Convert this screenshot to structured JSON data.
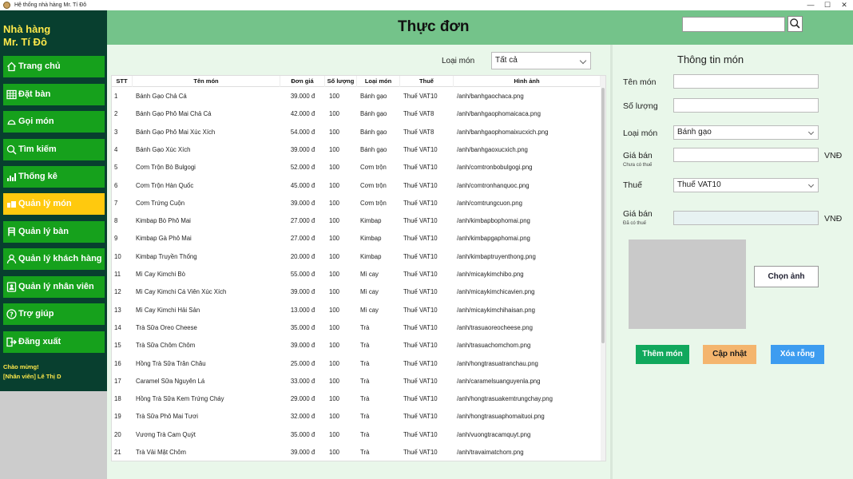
{
  "window": {
    "title": "Hệ thống nhà hàng Mr. Tí Đô",
    "controls": [
      "—",
      "☐",
      "✕"
    ]
  },
  "sidebar": {
    "brand_line1": "Nhà hàng",
    "brand_line2": "Mr. Tí Đô",
    "items": [
      {
        "label": "Trang chủ",
        "icon": "home-icon"
      },
      {
        "label": "Đặt bàn",
        "icon": "calendar-icon"
      },
      {
        "label": "Gọi món",
        "icon": "dish-icon"
      },
      {
        "label": "Tìm kiếm",
        "icon": "search-icon"
      },
      {
        "label": "Thống kê",
        "icon": "chart-icon"
      },
      {
        "label": "Quản lý món",
        "icon": "menu-icon",
        "active": true
      },
      {
        "label": "Quản lý bàn",
        "icon": "table-icon"
      },
      {
        "label": "Quản lý khách hàng",
        "icon": "user-icon"
      },
      {
        "label": "Quản lý nhân viên",
        "icon": "staff-icon"
      },
      {
        "label": "Trợ giúp",
        "icon": "help-icon"
      },
      {
        "label": "Đăng xuất",
        "icon": "logout-icon"
      }
    ],
    "greeting": "Chào mừng!",
    "user": "[Nhân viên] Lê Thị D"
  },
  "header": {
    "title": "Thực đơn",
    "search_value": ""
  },
  "filter": {
    "label": "Loại món",
    "value": "Tất cả"
  },
  "table": {
    "columns": [
      "STT",
      "Tên món",
      "Đơn giá",
      "Số lượng",
      "Loại món",
      "Thuế",
      "Hình ảnh"
    ],
    "rows": [
      [
        "1",
        "Bánh Gạo Chả Cá",
        "39.000 đ",
        "100",
        "Bánh gạo",
        "Thuế VAT10",
        "/anh/banhgaochaca.png"
      ],
      [
        "2",
        "Bánh Gạo Phô Mai Chả Cá",
        "42.000 đ",
        "100",
        "Bánh gạo",
        "Thuế VAT8",
        "/anh/banhgaophomaicaca.png"
      ],
      [
        "3",
        "Bánh Gạo Phô Mai Xúc Xích",
        "54.000 đ",
        "100",
        "Bánh gạo",
        "Thuế VAT8",
        "/anh/banhgaophomaixucxich.png"
      ],
      [
        "4",
        "Bánh Gạo Xúc Xích",
        "39.000 đ",
        "100",
        "Bánh gạo",
        "Thuế VAT10",
        "/anh/banhgaoxucxich.png"
      ],
      [
        "5",
        "Cơm Trộn Bò Bulgogi",
        "52.000 đ",
        "100",
        "Cơm trộn",
        "Thuế VAT10",
        "/anh/comtronbobulgogi.png"
      ],
      [
        "6",
        "Cơm Trộn Hàn Quốc",
        "45.000 đ",
        "100",
        "Cơm trộn",
        "Thuế VAT10",
        "/anh/comtronhanquoc.png"
      ],
      [
        "7",
        "Cơm Trứng Cuộn",
        "39.000 đ",
        "100",
        "Cơm trộn",
        "Thuế VAT10",
        "/anh/comtrungcuon.png"
      ],
      [
        "8",
        "Kimbap Bò Phô Mai",
        "27.000 đ",
        "100",
        "Kimbap",
        "Thuế VAT10",
        "/anh/kimbapbophomai.png"
      ],
      [
        "9",
        "Kimbap Gà Phô Mai",
        "27.000 đ",
        "100",
        "Kimbap",
        "Thuế VAT10",
        "/anh/kimbapgaphomai.png"
      ],
      [
        "10",
        "Kimbap Truyền Thống",
        "20.000 đ",
        "100",
        "Kimbap",
        "Thuế VAT10",
        "/anh/kimbaptruyenthong.png"
      ],
      [
        "11",
        "Mì Cay Kimchi Bò",
        "55.000 đ",
        "100",
        "Mì cay",
        "Thuế VAT10",
        "/anh/micaykimchibo.png"
      ],
      [
        "12",
        "Mì Cay Kimchi Cá Viên Xúc Xích",
        "39.000 đ",
        "100",
        "Mì cay",
        "Thuế VAT10",
        "/anh/micaykimchicavien.png"
      ],
      [
        "13",
        "Mì Cay Kimchi Hải Sản",
        "13.000 đ",
        "100",
        "Mì cay",
        "Thuế VAT10",
        "/anh/micaykimchihaisan.png"
      ],
      [
        "14",
        "Trà Sữa Oreo Cheese",
        "35.000 đ",
        "100",
        "Trà",
        "Thuế VAT10",
        "/anh/trasuaoreocheese.png"
      ],
      [
        "15",
        "Trà Sữa Chôm Chôm",
        "39.000 đ",
        "100",
        "Trà",
        "Thuế VAT10",
        "/anh/trasuachomchom.png"
      ],
      [
        "16",
        "Hồng Trà Sữa Trân Châu",
        "25.000 đ",
        "100",
        "Trà",
        "Thuế VAT10",
        "/anh/hongtrasuatranchau.png"
      ],
      [
        "17",
        "Caramel Sữa Nguyên Lá",
        "33.000 đ",
        "100",
        "Trà",
        "Thuế VAT10",
        "/anh/caramelsuanguyenla.png"
      ],
      [
        "18",
        "Hồng Trà Sữa Kem Trứng Cháy",
        "29.000 đ",
        "100",
        "Trà",
        "Thuế VAT10",
        "/anh/hongtrasuakemtrungchay.png"
      ],
      [
        "19",
        "Trà Sữa Phô Mai Tươi",
        "32.000 đ",
        "100",
        "Trà",
        "Thuế VAT10",
        "/anh/hongtrasuaphomaituoi.png"
      ],
      [
        "20",
        "Vương Trà Cam Quýt",
        "35.000 đ",
        "100",
        "Trà",
        "Thuế VAT10",
        "/anh/vuongtracamquyt.png"
      ],
      [
        "21",
        "Trà Vải Mật Chôm",
        "39.000 đ",
        "100",
        "Trà",
        "Thuế VAT10",
        "/anh/travaimatchom.png"
      ]
    ]
  },
  "detail": {
    "title": "Thông tin món",
    "name_label": "Tên món",
    "qty_label": "Số lượng",
    "category_label": "Loại món",
    "category_value": "Bánh gạo",
    "price_label": "Giá bán",
    "price_sub": "Chưa có thuế",
    "tax_label": "Thuế",
    "tax_value": "Thuế VAT10",
    "price_tax_label": "Giá bán",
    "price_tax_sub": "Đã có thuế",
    "currency": "VNĐ",
    "choose_image": "Chọn ảnh",
    "add_label": "Thêm món",
    "update_label": "Cập nhật",
    "clear_label": "Xóa rỗng"
  },
  "colors": {
    "sidebar_bg": "#083f2f",
    "nav_green": "#16a11c",
    "nav_active": "#ffc90e",
    "brand_yellow": "#ffe94a",
    "header_green": "#74c38a",
    "add_button": "#11a85d",
    "update_button": "#f4b56e",
    "clear_button": "#3d9cf0"
  }
}
